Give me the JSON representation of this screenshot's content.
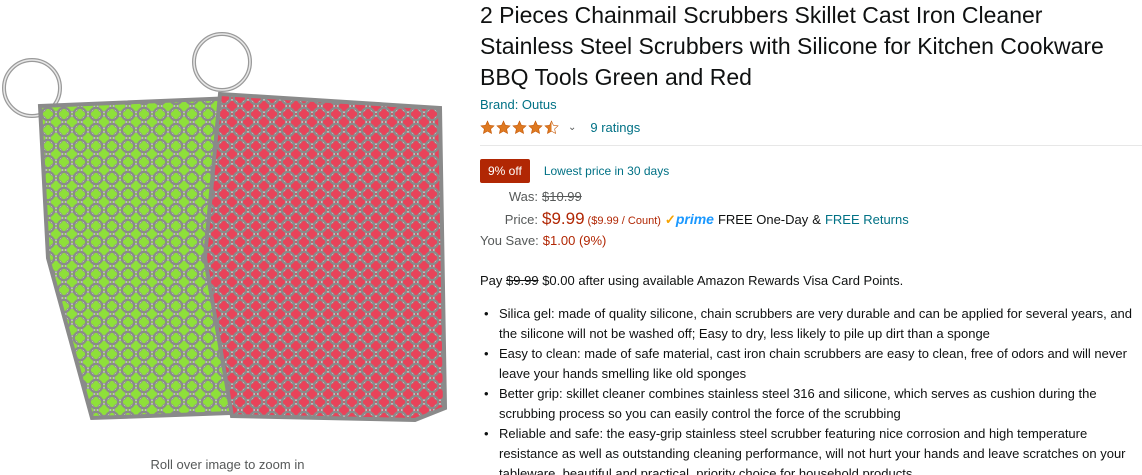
{
  "image": {
    "zoom_hint": "Roll over image to zoom in"
  },
  "product": {
    "title": "2 Pieces Chainmail Scrubbers Skillet Cast Iron Cleaner Stainless Steel Scrubbers with Silicone for Kitchen Cookware BBQ Tools Green and Red",
    "brand": "Brand: Outus",
    "rating_value": 4.5,
    "ratings_count": "9 ratings"
  },
  "deal": {
    "badge": "9% off",
    "note": "Lowest price in 30 days"
  },
  "price": {
    "was_label": "Was:",
    "was_value": "$10.99",
    "price_label": "Price:",
    "price_value": "$9.99",
    "unit_value": "($9.99 / Count)",
    "prime_check": "✓",
    "prime_word": "prime",
    "free_one_day": "FREE One-Day",
    "amp": "&",
    "free_returns": "FREE Returns",
    "save_label": "You Save:",
    "save_value": "$1.00 (9%)"
  },
  "pay": {
    "prefix": "Pay",
    "strike": "$9.99",
    "suffix": "$0.00 after using available Amazon Rewards Visa Card Points."
  },
  "bullets": [
    "Silica gel: made of quality silicone, chain scrubbers are very durable and can be applied for several years, and the silicone will not be washed off; Easy to dry, less likely to pile up dirt than a sponge",
    "Easy to clean: made of safe material, cast iron chain scrubbers are easy to clean, free of odors and will never leave your hands smelling like old sponges",
    "Better grip: skillet cleaner combines stainless steel 316 and silicone, which serves as cushion during the scrubbing process so you can easily control the force of the scrubbing",
    "Reliable and safe: the easy-grip stainless steel scrubber featuring nice corrosion and high temperature resistance as well as outstanding cleaning performance, will not hurt your hands and leave scratches on your tableware, beautiful and practical, priority choice for household products"
  ],
  "colors": {
    "accent_red": "#b12704",
    "link_teal": "#007185",
    "star_orange": "#de7921",
    "silicone_green": "#8ee03a",
    "silicone_red": "#e8435a",
    "prime_blue": "#1a98ff"
  }
}
